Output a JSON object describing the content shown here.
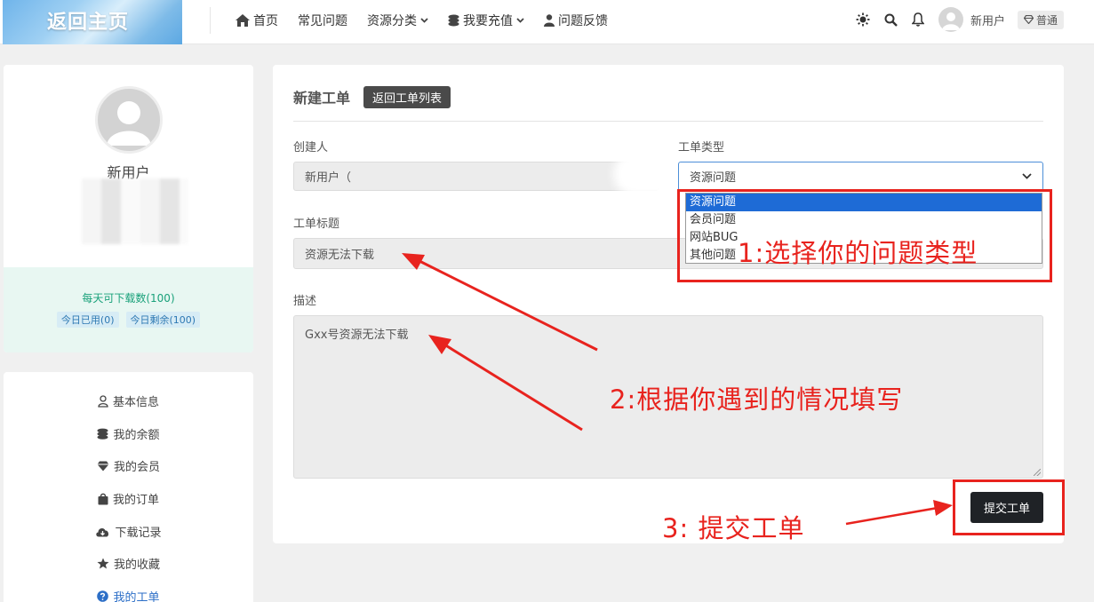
{
  "header": {
    "logo_text": "返回主页",
    "nav": [
      {
        "label": "首页",
        "icon": "home-icon"
      },
      {
        "label": "常见问题",
        "icon": ""
      },
      {
        "label": "资源分类",
        "icon": "chevron-down-icon"
      },
      {
        "label": "我要充值",
        "icon": "coins-icon"
      },
      {
        "label": "问题反馈",
        "icon": "user-icon"
      }
    ],
    "username": "新用户",
    "vip_label": "普通"
  },
  "sidebar": {
    "name": "新用户",
    "quota_main": "每天可下载数(100)",
    "used": "今日已用(0)",
    "remaining": "今日剩余(100)",
    "menu": [
      {
        "label": "基本信息",
        "icon": "user-outline-icon"
      },
      {
        "label": "我的余额",
        "icon": "coins-icon"
      },
      {
        "label": "我的会员",
        "icon": "diamond-icon"
      },
      {
        "label": "我的订单",
        "icon": "bag-icon"
      },
      {
        "label": "下载记录",
        "icon": "cloud-download-icon"
      },
      {
        "label": "我的收藏",
        "icon": "star-icon"
      },
      {
        "label": "我的工单",
        "icon": "question-circle-icon"
      }
    ]
  },
  "form": {
    "title": "新建工单",
    "back_label": "返回工单列表",
    "creator_label": "创建人",
    "creator_value": "新用户（",
    "type_label": "工单类型",
    "type_value": "资源问题",
    "type_options": [
      "资源问题",
      "会员问题",
      "网站BUG",
      "其他问题"
    ],
    "subject_label": "工单标题",
    "subject_value": "资源无法下载",
    "desc_label": "描述",
    "desc_value": "Gxx号资源无法下载",
    "submit_label": "提交工单"
  },
  "annotations": {
    "step1": "1:选择你的问题类型",
    "step2": "2:根据你遇到的情况填写",
    "step3": "3: 提交工单",
    "color": "#e8231e"
  }
}
